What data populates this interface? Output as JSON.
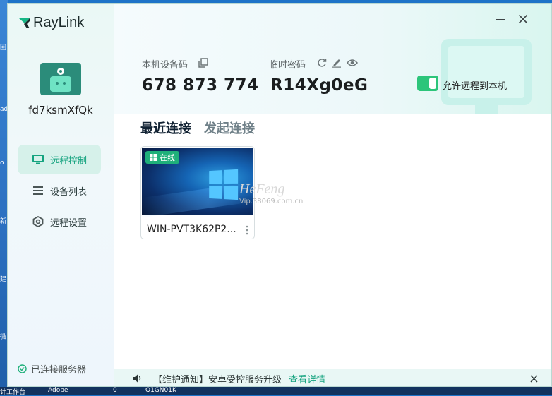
{
  "app": {
    "name": "RayLink"
  },
  "colors": {
    "accent": "#14a37f",
    "online": "#1fb07a",
    "toggle_on": "#2cc57a"
  },
  "desktop": {
    "side_glyphs": [
      "回",
      "ad",
      "o",
      "新",
      "建",
      "微"
    ],
    "taskbar_items": [
      "计工作台",
      "Adobe",
      "0",
      "Q1GN01K"
    ]
  },
  "sidebar": {
    "device_name": "fd7ksmXfQk",
    "items": [
      {
        "label": "远程控制",
        "icon": "monitor-icon",
        "active": true
      },
      {
        "label": "设备列表",
        "icon": "list-icon",
        "active": false
      },
      {
        "label": "远程设置",
        "icon": "settings-hex-icon",
        "active": false
      }
    ],
    "server_status": "已连接服务器"
  },
  "header": {
    "device_code_label": "本机设备码",
    "device_code": "678 873 774",
    "temp_password_label": "临时密码",
    "temp_password": "R14Xg0eG",
    "allow_remote_label": "允许远程到本机",
    "allow_remote_on": true
  },
  "tabs": [
    {
      "label": "最近连接",
      "active": true
    },
    {
      "label": "发起连接",
      "active": false
    }
  ],
  "recent": [
    {
      "status": "在线",
      "name": "WIN-PVT3K62P2..."
    }
  ],
  "watermark": {
    "brand": "HeFeng",
    "site": "Vip.38069.com.cn"
  },
  "notice": {
    "text": "【维护通知】安卓受控服务升级",
    "link": "查看详情"
  }
}
